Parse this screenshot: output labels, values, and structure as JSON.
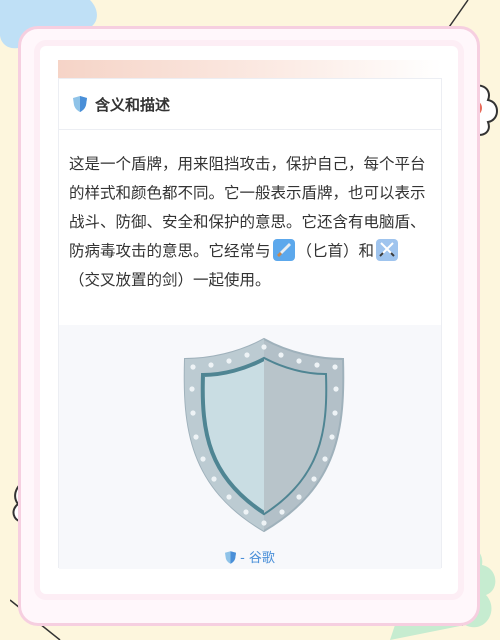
{
  "card": {
    "title": "含义和描述",
    "icon": "shield-icon",
    "description_parts": [
      "这是一个盾牌，用来阻挡攻击，保护自己，每个平台的样式和颜色都不同。它一般表示盾牌，也可以表示战斗、防御、安全和保护的意思。它还含有电脑盾、防病毒攻击的意思。它经常与",
      "（匕首）和",
      "（交叉放置的剑）一起使用。"
    ],
    "emojis": [
      "dagger-emoji",
      "crossed-swords-emoji"
    ],
    "image": {
      "alt_icon": "shield-emoji-image",
      "caption_suffix": "- 谷歌"
    }
  },
  "colors": {
    "page_bg": "#fdf6dd",
    "frame_border": "#f6cfe0",
    "caption_link": "#4a8fd8",
    "shield_body": "#b0bcc4",
    "shield_rim": "#8fa3ae"
  }
}
